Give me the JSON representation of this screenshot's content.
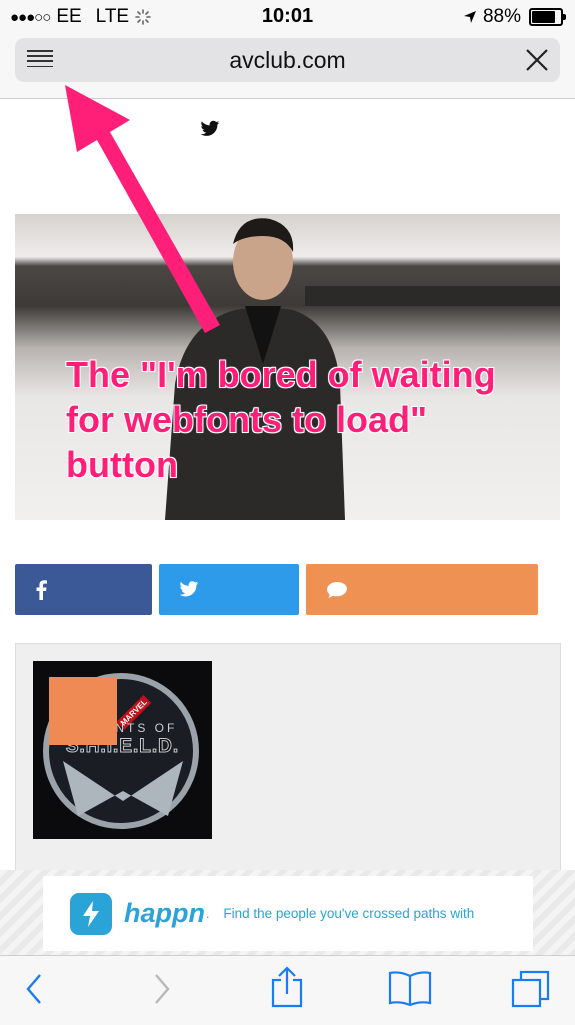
{
  "status_bar": {
    "carrier": "EE",
    "network": "LTE",
    "time": "10:01",
    "battery": "88%"
  },
  "browser": {
    "url": "avclub.com"
  },
  "hero": {
    "caption": "The \"I'm bored of waiting for webfonts to load\" button",
    "annotation_color": "#ff1f78"
  },
  "share_buttons": {
    "facebook_color": "#3a5996",
    "twitter_color": "#2d9be9",
    "comment_color": "#ef9153"
  },
  "related": {
    "thumbnail_marvel": "MARVEL",
    "thumbnail_agents": "AGENTS OF",
    "thumbnail_title": "S.H.I.E.L.D."
  },
  "ad": {
    "brand": "happn",
    "brand_suffix": ".",
    "tagline": "Find the people you've crossed paths with",
    "accent": "#2aa3d7"
  },
  "icons": {
    "menu": "hamburger-icon",
    "close": "close-icon",
    "back": "chevron-left-icon",
    "forward": "chevron-right-icon",
    "share": "share-icon",
    "bookmarks": "book-icon",
    "tabs": "tabs-icon"
  }
}
